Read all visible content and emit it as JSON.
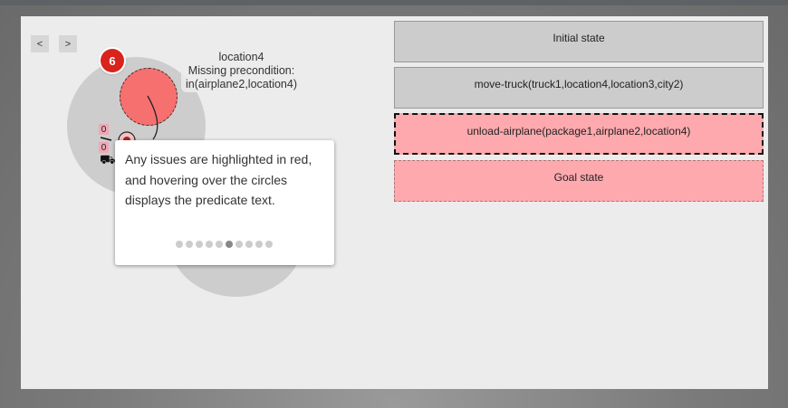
{
  "nav": {
    "prev_label": "<",
    "next_label": ">"
  },
  "graph": {
    "badge_count": "6",
    "node_label": {
      "location": "location4",
      "issue": "Missing precondition:",
      "predicate": "in(airplane2,location4)"
    },
    "pin_top": "0",
    "pin_bottom": "0",
    "truck_icon": "truck-icon"
  },
  "tour": {
    "text": "Any issues are highlighted in red, and hovering over the circles displays the predicate text.",
    "step_count": 10,
    "active_step": 6
  },
  "plan_steps": [
    {
      "label": "Initial state",
      "status": "ok"
    },
    {
      "label": "move-truck(truck1,location4,location3,city2)",
      "status": "ok"
    },
    {
      "label": "unload-airplane(package1,airplane2,location4)",
      "status": "error",
      "selected": true
    },
    {
      "label": "Goal state",
      "status": "error"
    }
  ],
  "colors": {
    "issue_red": "#f77070",
    "badge_red": "#d8241c",
    "state_grey": "#cccccc",
    "state_red": "#fda9ae"
  }
}
